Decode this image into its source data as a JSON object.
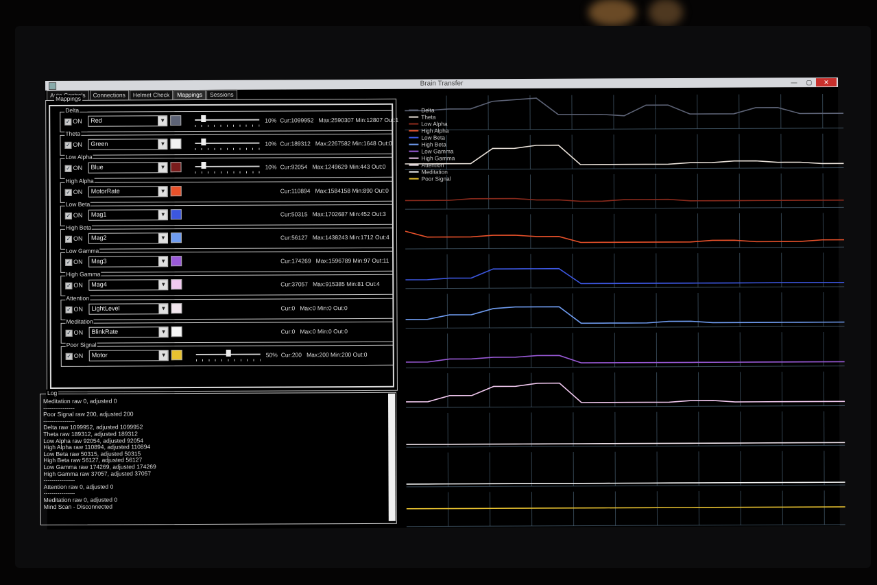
{
  "window": {
    "title": "Brain Transfer",
    "controls": {
      "minimize": "—",
      "maximize": "▢",
      "close": "✕"
    }
  },
  "tabs": [
    {
      "label": "Auto Controls",
      "active": false
    },
    {
      "label": "Connections",
      "active": false
    },
    {
      "label": "Helmet Check",
      "active": false
    },
    {
      "label": "Mappings",
      "active": true
    },
    {
      "label": "Sessions",
      "active": false
    }
  ],
  "mappings": {
    "group_label": "Mappings",
    "on_label": "ON",
    "rows": [
      {
        "name": "Delta",
        "target": "Red",
        "color": "#5c6275",
        "slider": 0.1,
        "pct": "10%",
        "stats": "Cur:1099952   Max:2590307 Min:12807 Out:1"
      },
      {
        "name": "Theta",
        "target": "Green",
        "color": "#f2f2f2",
        "slider": 0.1,
        "pct": "10%",
        "stats": "Cur:189312   Max:2267582 Min:1648 Out:0"
      },
      {
        "name": "Low Alpha",
        "target": "Blue",
        "color": "#7a1c1c",
        "slider": 0.1,
        "pct": "10%",
        "stats": "Cur:92054   Max:1249629 Min:443 Out:0"
      },
      {
        "name": "High Alpha",
        "target": "MotorRate",
        "color": "#e8512a",
        "stats": "Cur:110894   Max:1584158 Min:890 Out:0"
      },
      {
        "name": "Low Beta",
        "target": "Mag1",
        "color": "#3c57e0",
        "stats": "Cur:50315   Max:1702687 Min:452 Out:3"
      },
      {
        "name": "High Beta",
        "target": "Mag2",
        "color": "#6f9cf0",
        "stats": "Cur:56127   Max:1438243 Min:1712 Out:4"
      },
      {
        "name": "Low Gamma",
        "target": "Mag3",
        "color": "#9a5ad8",
        "stats": "Cur:174269   Max:1596789 Min:97 Out:11"
      },
      {
        "name": "High Gamma",
        "target": "Mag4",
        "color": "#f2c9f0",
        "stats": "Cur:37057   Max:915385 Min:81 Out:4"
      },
      {
        "name": "Attention",
        "target": "LightLevel",
        "color": "#f2e6ee",
        "stats": "Cur:0   Max:0 Min:0 Out:0"
      },
      {
        "name": "Meditation",
        "target": "BlinkRate",
        "color": "#f6f6f6",
        "stats": "Cur:0   Max:0 Min:0 Out:0"
      },
      {
        "name": "Poor Signal",
        "target": "Motor",
        "color": "#e8c230",
        "slider": 0.5,
        "pct": "50%",
        "stats": "Cur:200   Max:200 Min:200 Out:0"
      }
    ]
  },
  "log": {
    "label": "Log",
    "lines": [
      "Meditation raw 0, adjusted 0",
      "----------------",
      "Poor Signal raw 200, adjusted 200",
      "----------------",
      "Delta raw 1099952, adjusted 1099952",
      "Theta raw 189312, adjusted 189312",
      "Low Alpha raw 92054, adjusted 92054",
      "High Alpha raw 110894, adjusted 110894",
      "Low Beta raw 50315, adjusted 50315",
      "High Beta raw 56127, adjusted 56127",
      "Low Gamma raw 174269, adjusted 174269",
      "High Gamma raw 37057, adjusted 37057",
      "----------------",
      "Attention raw 0, adjusted 0",
      "----------------",
      "Meditation raw 0, adjusted 0",
      "Mind Scan - Disconnected"
    ]
  },
  "chart_legend": [
    {
      "name": "Delta",
      "color": "#5c6275"
    },
    {
      "name": "Theta",
      "color": "#e8e0d8"
    },
    {
      "name": "Low Alpha",
      "color": "#8a2a1c"
    },
    {
      "name": "High Alpha",
      "color": "#e8512a"
    },
    {
      "name": "Low Beta",
      "color": "#3c57e0"
    },
    {
      "name": "High Beta",
      "color": "#6f9cf0"
    },
    {
      "name": "Low Gamma",
      "color": "#9a5ad8"
    },
    {
      "name": "High Gamma",
      "color": "#f2c9f0"
    },
    {
      "name": "Attention",
      "color": "#f2e6ee"
    },
    {
      "name": "Meditation",
      "color": "#f6f6f6"
    },
    {
      "name": "Poor Signal",
      "color": "#e8c230"
    }
  ],
  "chart_data": {
    "type": "line",
    "title": "",
    "xlabel": "",
    "ylabel": "",
    "grid": true,
    "legend_position": "top-right",
    "x": [
      0,
      1,
      2,
      3,
      4,
      5,
      6,
      7,
      8,
      9,
      10,
      11,
      12,
      13,
      14,
      15,
      16,
      17,
      18,
      19,
      20
    ],
    "series": [
      {
        "name": "Delta",
        "color": "#5c6275",
        "values": [
          0.55,
          0.55,
          0.6,
          0.6,
          0.85,
          0.9,
          0.95,
          0.4,
          0.4,
          0.4,
          0.35,
          0.7,
          0.7,
          0.4,
          0.4,
          0.4,
          0.6,
          0.6,
          0.4,
          0.4,
          0.4
        ]
      },
      {
        "name": "Theta",
        "color": "#e8e0d8",
        "values": [
          0.1,
          0.1,
          0.1,
          0.1,
          0.6,
          0.6,
          0.7,
          0.7,
          0.05,
          0.05,
          0.05,
          0.05,
          0.05,
          0.1,
          0.1,
          0.15,
          0.15,
          0.1,
          0.1,
          0.05,
          0.05
        ]
      },
      {
        "name": "Low Alpha",
        "color": "#8a2a1c",
        "values": [
          0.2,
          0.2,
          0.2,
          0.25,
          0.25,
          0.25,
          0.2,
          0.2,
          0.15,
          0.15,
          0.2,
          0.2,
          0.2,
          0.15,
          0.15,
          0.15,
          0.15,
          0.15,
          0.15,
          0.15,
          0.15
        ]
      },
      {
        "name": "High Alpha",
        "color": "#e8512a",
        "values": [
          0.5,
          0.3,
          0.3,
          0.3,
          0.35,
          0.35,
          0.3,
          0.3,
          0.1,
          0.1,
          0.1,
          0.1,
          0.1,
          0.1,
          0.15,
          0.15,
          0.1,
          0.1,
          0.1,
          0.15,
          0.15
        ]
      },
      {
        "name": "Low Beta",
        "color": "#3c57e0",
        "values": [
          0.2,
          0.2,
          0.25,
          0.25,
          0.55,
          0.55,
          0.55,
          0.55,
          0.05,
          0.05,
          0.05,
          0.05,
          0.05,
          0.05,
          0.05,
          0.05,
          0.05,
          0.05,
          0.05,
          0.05,
          0.05
        ]
      },
      {
        "name": "High Beta",
        "color": "#6f9cf0",
        "values": [
          0.2,
          0.2,
          0.35,
          0.35,
          0.55,
          0.6,
          0.6,
          0.6,
          0.05,
          0.05,
          0.05,
          0.05,
          0.1,
          0.1,
          0.05,
          0.05,
          0.05,
          0.05,
          0.05,
          0.05,
          0.05
        ]
      },
      {
        "name": "Low Gamma",
        "color": "#9a5ad8",
        "values": [
          0.1,
          0.1,
          0.2,
          0.2,
          0.25,
          0.25,
          0.3,
          0.3,
          0.05,
          0.05,
          0.05,
          0.05,
          0.05,
          0.05,
          0.05,
          0.05,
          0.05,
          0.05,
          0.05,
          0.05,
          0.05
        ]
      },
      {
        "name": "High Gamma",
        "color": "#f2c9f0",
        "values": [
          0.1,
          0.1,
          0.3,
          0.3,
          0.6,
          0.6,
          0.7,
          0.7,
          0.05,
          0.05,
          0.05,
          0.05,
          0.05,
          0.1,
          0.1,
          0.05,
          0.05,
          0.05,
          0.05,
          0.05,
          0.05
        ]
      },
      {
        "name": "Attention",
        "color": "#f2e6ee",
        "values": [
          0,
          0,
          0,
          0,
          0,
          0,
          0,
          0,
          0,
          0,
          0,
          0,
          0,
          0,
          0,
          0,
          0,
          0,
          0,
          0,
          0
        ]
      },
      {
        "name": "Meditation",
        "color": "#f6f6f6",
        "values": [
          0,
          0,
          0,
          0,
          0,
          0,
          0,
          0,
          0,
          0,
          0,
          0,
          0,
          0,
          0,
          0,
          0,
          0,
          0,
          0,
          0
        ]
      },
      {
        "name": "Poor Signal",
        "color": "#e8c230",
        "values": [
          0.5,
          0.5,
          0.5,
          0.5,
          0.5,
          0.5,
          0.5,
          0.5,
          0.5,
          0.5,
          0.5,
          0.5,
          0.5,
          0.5,
          0.5,
          0.5,
          0.5,
          0.5,
          0.5,
          0.5,
          0.5
        ]
      }
    ]
  }
}
